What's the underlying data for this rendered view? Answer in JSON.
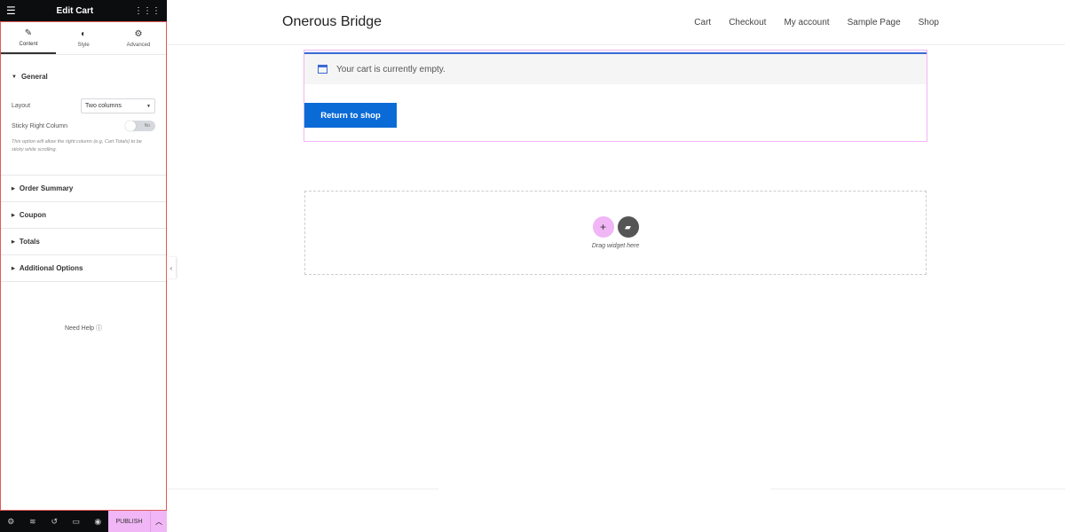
{
  "panel": {
    "title": "Edit Cart",
    "tabs": [
      {
        "label": "Content",
        "icon": "pencil-icon"
      },
      {
        "label": "Style",
        "icon": "contrast-icon"
      },
      {
        "label": "Advanced",
        "icon": "gear-icon"
      }
    ],
    "general": {
      "title": "General",
      "layout_label": "Layout",
      "layout_value": "Two columns",
      "sticky_label": "Sticky Right Column",
      "sticky_toggle": "No",
      "sticky_enabled": false,
      "description": "This option will allow the right column (e.g, Cart Totals) to be sticky while scrolling."
    },
    "sections": [
      "Order Summary",
      "Coupon",
      "Totals",
      "Additional Options"
    ],
    "help": "Need Help",
    "publish": "PUBLISH",
    "accent_color": "#f0b6f5"
  },
  "site": {
    "brand": "Onerous Bridge",
    "nav": [
      "Cart",
      "Checkout",
      "My account",
      "Sample Page",
      "Shop"
    ],
    "notice": "Your cart is currently empty.",
    "return_button": "Return to shop",
    "drop_text": "Drag widget here",
    "button_color": "#0b6bd6"
  }
}
